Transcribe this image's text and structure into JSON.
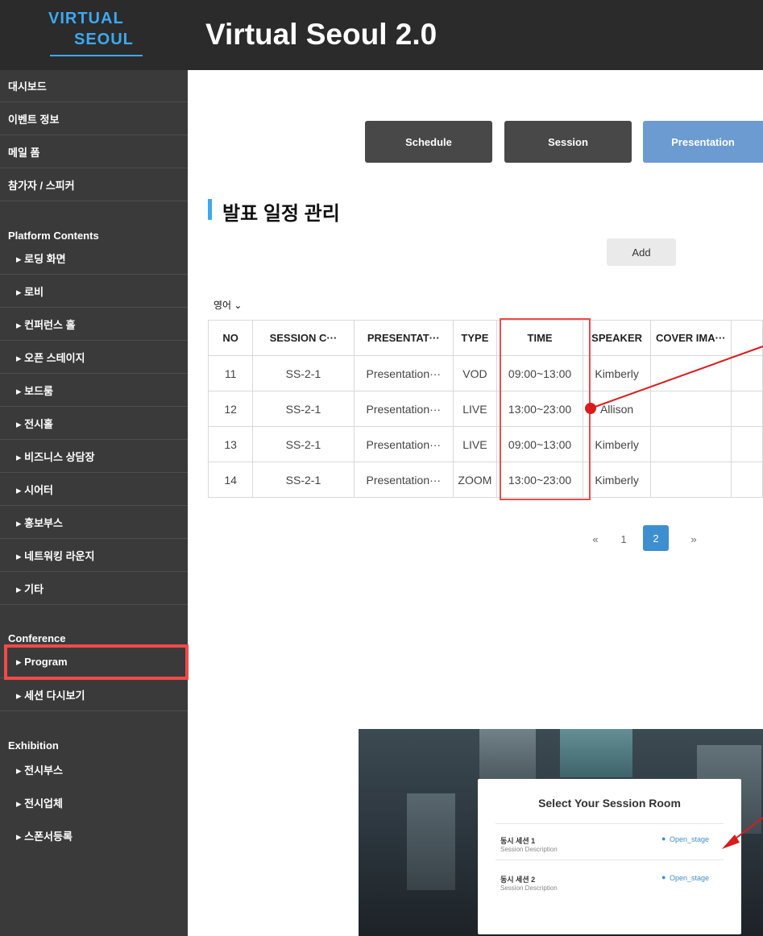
{
  "header": {
    "logo_line1": "VIRTUAL",
    "logo_line2": "SEOUL",
    "title": "Virtual Seoul 2.0"
  },
  "sidebar": {
    "top_items": [
      "대시보드",
      "이벤트 정보",
      "메일 폼",
      "참가자 / 스피커"
    ],
    "platform_heading": "Platform Contents",
    "platform_items": [
      "▸ 로딩 화면",
      "▸ 로비",
      "▸ 컨퍼런스 홀",
      "▸ 오픈 스테이지",
      "▸ 보드룸",
      "▸ 전시홀",
      "▸ 비즈니스 상담장",
      "▸ 시어터",
      "▸ 홍보부스",
      "▸ 네트워킹 라운지",
      "▸ 기타"
    ],
    "conference_heading": "Conference",
    "conference_items": [
      "▸ Program",
      "▸ 세션 다시보기"
    ],
    "exhibition_heading": "Exhibition",
    "exhibition_items": [
      "▸ 전시부스",
      "▸ 전시업체",
      "▸ 스폰서등록"
    ]
  },
  "tabs": {
    "schedule": "Schedule",
    "session": "Session",
    "presentation": "Presentation",
    "active": "Presentation"
  },
  "section": {
    "title": "발표 일정 관리",
    "add_label": "Add",
    "language": "영어 ⌄"
  },
  "table": {
    "headers": [
      "NO",
      "SESSION C···",
      "PRESENTAT···",
      "TYPE",
      "TIME",
      "SPEAKER",
      "COVER IMA···"
    ],
    "rows": [
      [
        "11",
        "SS-2-1",
        "Presentation···",
        "VOD",
        "09:00~13:00",
        "Kimberly",
        ""
      ],
      [
        "12",
        "SS-2-1",
        "Presentation···",
        "LIVE",
        "13:00~23:00",
        "Allison",
        ""
      ],
      [
        "13",
        "SS-2-1",
        "Presentation···",
        "LIVE",
        "09:00~13:00",
        "Kimberly",
        ""
      ],
      [
        "14",
        "SS-2-1",
        "Presentation···",
        "ZOOM",
        "13:00~23:00",
        "Kimberly",
        ""
      ]
    ]
  },
  "pagination": {
    "prev": "«",
    "pages": [
      "1",
      "2"
    ],
    "current": "2",
    "next": "»"
  },
  "preview": {
    "modal_title": "Select Your Session Room",
    "rooms": [
      {
        "name": "동시 세션 1",
        "desc": "Session Description",
        "link": "Open_stage"
      },
      {
        "name": "동시 세션 2",
        "desc": "Session Description",
        "link": "Open_stage"
      }
    ]
  },
  "colors": {
    "header_bg": "#2b2b2b",
    "sidebar_bg": "#3a3a3a",
    "accent": "#3da9f0",
    "tab_active": "#6b9bd1",
    "tab_inactive": "#484848",
    "annotation_red": "#f04a4a",
    "page_active": "#3d8fd0"
  }
}
